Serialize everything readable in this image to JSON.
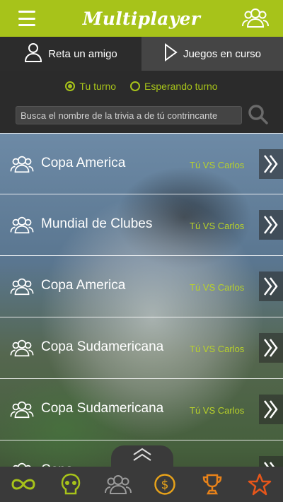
{
  "header": {
    "title": "Multiplayer",
    "menu_icon": "menu-icon",
    "group_icon": "group-icon"
  },
  "tabs": [
    {
      "label": "Reta un amigo",
      "icon": "user-icon"
    },
    {
      "label": "Juegos en curso",
      "icon": "play-icon"
    }
  ],
  "filter": {
    "options": [
      {
        "label": "Tu turno",
        "selected": true
      },
      {
        "label": "Esperando turno",
        "selected": false
      }
    ],
    "search_placeholder": "Busca el nombre de la trivia a de tú contrincante"
  },
  "games": [
    {
      "name": "Copa America",
      "vs": "Tú VS Carlos"
    },
    {
      "name": "Mundial de Clubes",
      "vs": "Tú VS Carlos"
    },
    {
      "name": "Copa America",
      "vs": "Tú VS Carlos"
    },
    {
      "name": "Copa Sudamericana",
      "vs": "Tú VS Carlos"
    },
    {
      "name": "Copa Sudamericana",
      "vs": "Tú VS Carlos"
    },
    {
      "name": "Copa ...",
      "vs": ""
    }
  ],
  "bottom_nav": [
    "infinity-icon",
    "skull-icon",
    "group-icon",
    "coin-icon",
    "trophy-icon",
    "star-icon"
  ],
  "colors": {
    "accent": "#a7c31a",
    "bar": "#2b2b2b",
    "tab_active": "#454545"
  }
}
